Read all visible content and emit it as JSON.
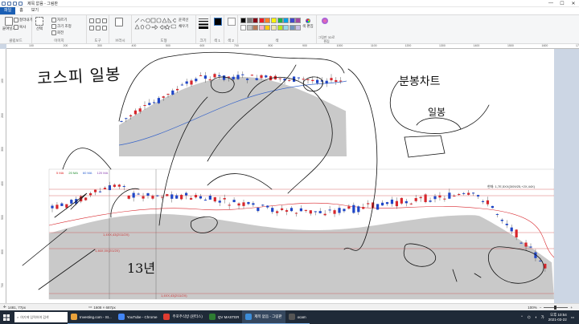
{
  "window": {
    "title": "제목 없음 - 그림판",
    "minimize": "—",
    "maximize": "☐",
    "close": "✕"
  },
  "tabs": [
    {
      "label": "파일",
      "active": true
    },
    {
      "label": "홈",
      "active": false
    },
    {
      "label": "보기",
      "active": false
    }
  ],
  "ribbon": {
    "clipboard": {
      "paste": "붙여넣기",
      "cut": "잘라내기",
      "copy": "복사",
      "label": "클립보드"
    },
    "image": {
      "select": "선택",
      "crop": "자르기",
      "resize": "크기 조정",
      "rotate": "회전",
      "label": "이미지"
    },
    "tools": {
      "label": "도구"
    },
    "brushes": {
      "label": "브러시"
    },
    "shapes": {
      "outline": "윤곽선",
      "fill": "채우기",
      "label": "도형"
    },
    "size": {
      "label": "크기"
    },
    "color1": {
      "label": "색 1"
    },
    "color2": {
      "label": "색 2"
    },
    "colors": {
      "edit": "색 편집",
      "label": "색"
    },
    "paint3d": {
      "label": "그림판 3D로 편집"
    },
    "palette": [
      "#000000",
      "#7f7f7f",
      "#880015",
      "#ed1c24",
      "#ff7f27",
      "#fff200",
      "#22b14c",
      "#00a2e8",
      "#3f48cc",
      "#a349a4",
      "#ffffff",
      "#c3c3c3",
      "#b97a57",
      "#ffaec9",
      "#ffc90e",
      "#efe4b0",
      "#b5e61d",
      "#99d9ea",
      "#7092be",
      "#c8bfe7"
    ]
  },
  "ruler": {
    "top": [
      "100",
      "200",
      "300",
      "400",
      "500",
      "600",
      "700",
      "800",
      "900",
      "1000",
      "1100",
      "1200",
      "1300",
      "1400",
      "1500",
      "1600",
      "1700"
    ],
    "left": [
      "100",
      "200",
      "300",
      "400",
      "500",
      "600",
      "700",
      "800"
    ]
  },
  "chart_top": {
    "annotation_handwritten": "코스피 일봉",
    "ma_labels": ""
  },
  "chart_bottom": {
    "ma_legend": [
      "5 MA",
      "20 MA",
      "60 MA",
      "120 MA"
    ],
    "info_text": "현재: 1,7E,5XX(3/09/25,+2X,44X)",
    "levels": [
      {
        "label": "1,4XX,43(2/11/2X)"
      },
      {
        "label": "1,46X,0X(2/1/2X)"
      },
      {
        "label": "1,4XX,43(2/11/2X)"
      }
    ],
    "handwritten_13": "13년",
    "handwritten_note": "분봉차트",
    "handwritten_sub": "일봉"
  },
  "status": {
    "cursor": "1481, 77px",
    "selection": "",
    "dimensions": "1608 × 687px",
    "zoom": "100%"
  },
  "taskbar": {
    "search_placeholder": "여기에 입력하여 검색",
    "apps": [
      {
        "label": "Investing.com - St...",
        "color": "#e9a23b"
      },
      {
        "label": "YouTube - Chrome",
        "color": "#4285f4"
      },
      {
        "label": "주포주식방 (윈터스)",
        "color": "#e03c31"
      },
      {
        "label": "QV MASTER",
        "color": "#2e7d32"
      },
      {
        "label": "제목 없음 - 그림판",
        "color": "#3c8dd9"
      },
      {
        "label": "ocam",
        "color": "#555555"
      }
    ],
    "time": "오후 10:54",
    "date": "2021-03-22",
    "ime": "가"
  }
}
